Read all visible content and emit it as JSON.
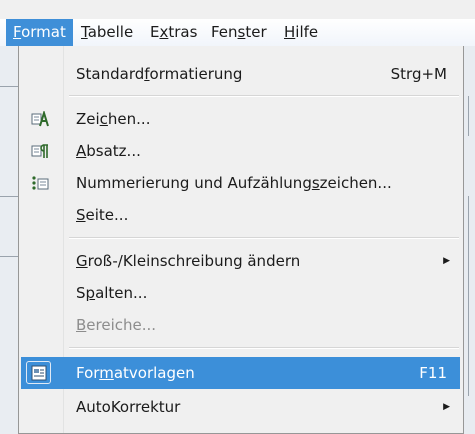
{
  "menubar": {
    "items": [
      {
        "label": "Format",
        "mnemonic": "F",
        "active": true
      },
      {
        "label": "Tabelle",
        "mnemonic": "T"
      },
      {
        "label": "Extras",
        "mnemonic": "x"
      },
      {
        "label": "Fenster",
        "mnemonic": "s"
      },
      {
        "label": "Hilfe",
        "mnemonic": "H"
      }
    ]
  },
  "format_menu": {
    "items": [
      {
        "label": "Standardformatierung",
        "shortcut": "Strg+M"
      },
      {
        "label": "Zeichen...",
        "icon": "character-format-icon"
      },
      {
        "label": "Absatz...",
        "icon": "paragraph-format-icon"
      },
      {
        "label": "Nummerierung und Aufzählungszeichen...",
        "icon": "numbering-icon"
      },
      {
        "label": "Seite..."
      },
      {
        "label": "Groß-/Kleinschreibung ändern",
        "submenu": true
      },
      {
        "label": "Spalten..."
      },
      {
        "label": "Bereiche...",
        "disabled": true
      },
      {
        "label": "Formatvorlagen",
        "shortcut": "F11",
        "icon": "styles-icon",
        "highlighted": true
      },
      {
        "label": "AutoKorrektur",
        "submenu": true
      }
    ]
  },
  "colors": {
    "highlight": "#3c8fd9",
    "menubar_active": "#3f8fd8",
    "disabled_text": "#8d8d8d"
  }
}
